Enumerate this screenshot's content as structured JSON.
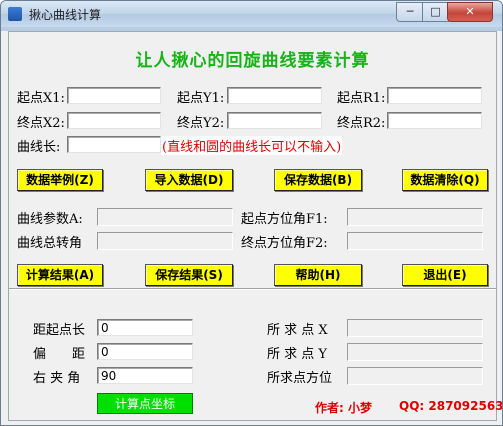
{
  "window": {
    "title": "揪心曲线计算",
    "minimize": "─",
    "maximize": "□",
    "close": "✕"
  },
  "heading": "让人揪心的回旋曲线要素计算",
  "inputs": {
    "start_x": {
      "label": "起点X1:",
      "value": ""
    },
    "start_y": {
      "label": "起点Y1:",
      "value": ""
    },
    "start_r": {
      "label": "起点R1:",
      "value": ""
    },
    "end_x": {
      "label": "终点X2:",
      "value": ""
    },
    "end_y": {
      "label": "终点Y2:",
      "value": ""
    },
    "end_r": {
      "label": "终点R2:",
      "value": ""
    },
    "curve_length": {
      "label": "曲线长:",
      "value": ""
    },
    "note": "(直线和圆的曲线长可以不输入)"
  },
  "buttons_row1": {
    "example": "数据举例(Z)",
    "import": "导入数据(D)",
    "save_data": "保存数据(B)",
    "clear": "数据清除(Q)"
  },
  "results": {
    "curve_param": "曲线参数A:",
    "start_azimuth": "起点方位角F1:",
    "total_angle": "曲线总转角",
    "end_azimuth": "终点方位角F2:"
  },
  "buttons_row2": {
    "calc": "计算结果(A)",
    "save_result": "保存结果(S)",
    "help": "帮助(H)",
    "exit": "退出(E)"
  },
  "point_calc": {
    "distance_label": "距起点长",
    "distance_value": "0",
    "offset_label": "偏　　距",
    "offset_value": "0",
    "angle_label": "右 夹 角",
    "angle_value": "90",
    "point_x_label": "所 求 点 X",
    "point_y_label": "所 求 点 Y",
    "point_azimuth_label": "所求点方位",
    "compute_button": "计算点坐标"
  },
  "footer": {
    "author": "作者: 小梦",
    "qq": "QQ: 287092563"
  },
  "colors": {
    "heading": "#17b317",
    "button_yellow": "#ffff00",
    "button_green": "#00e000",
    "note_red": "#e00000"
  }
}
